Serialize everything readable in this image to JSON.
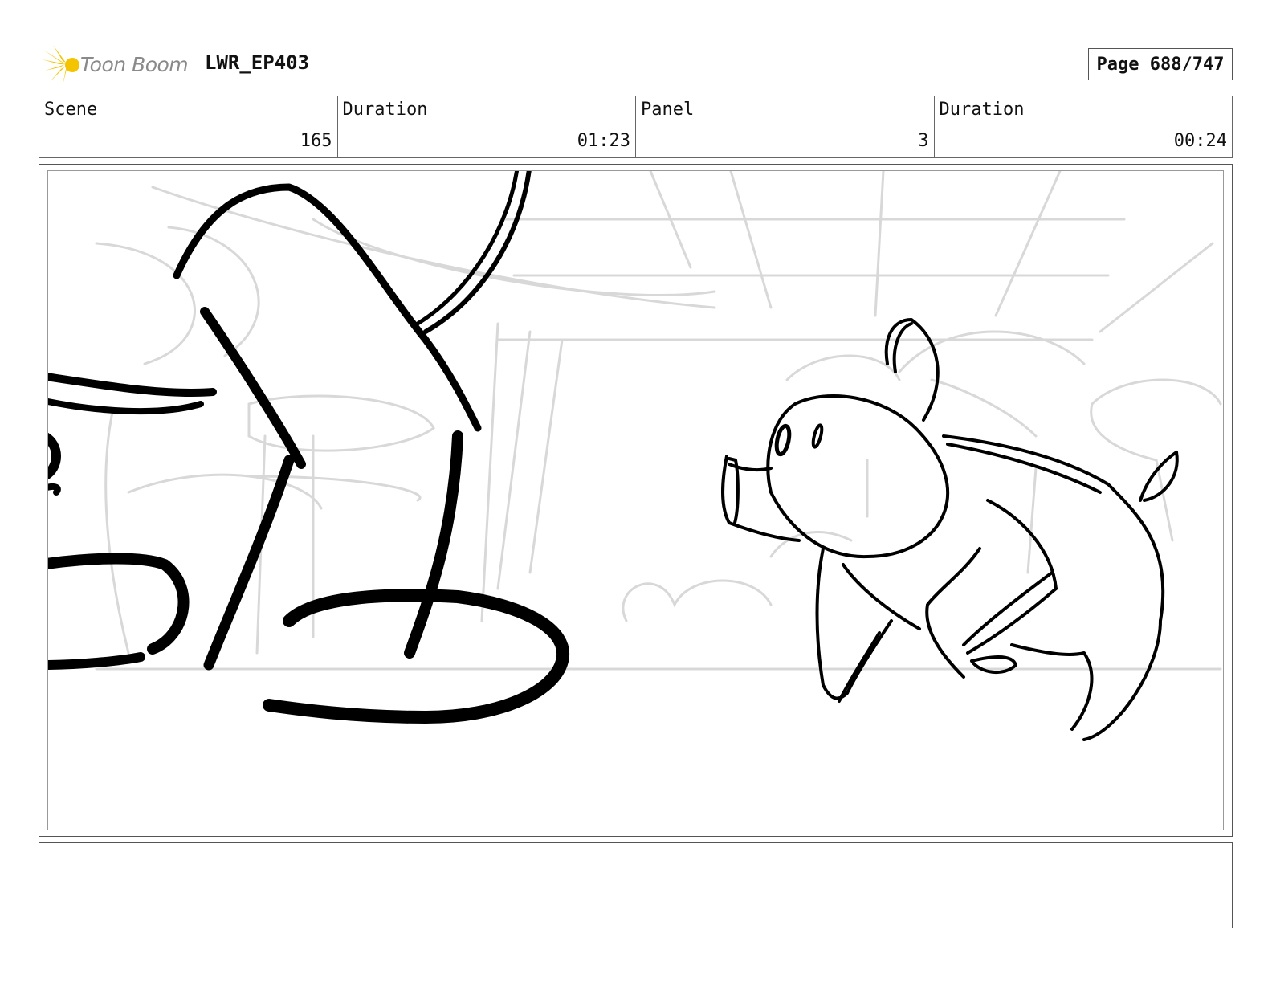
{
  "header": {
    "logo_text": "Toon Boom",
    "project_name": "LWR_EP403",
    "page_label": "Page 688/747"
  },
  "info": {
    "scene_label": "Scene",
    "scene_value": "165",
    "scene_duration_label": "Duration",
    "scene_duration_value": "01:23",
    "panel_label": "Panel",
    "panel_value": "3",
    "panel_duration_label": "Duration",
    "panel_duration_value": "00:24"
  },
  "colors": {
    "logo_yellow": "#f5c400",
    "ink": "#000000",
    "rough_sketch": "#d6d6d6"
  }
}
